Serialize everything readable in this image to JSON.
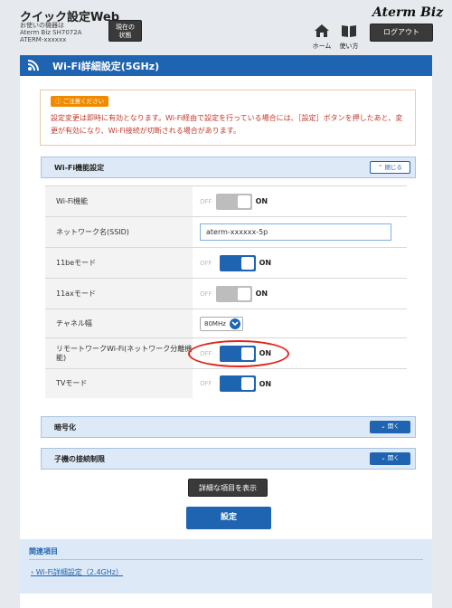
{
  "header": {
    "app_title": "クイック設定Web",
    "device_lines": [
      "お使いの機器は",
      "Aterm Biz SH7072A",
      "ATERM-xxxxxx"
    ],
    "status_button": [
      "現在の",
      "状態"
    ],
    "logo": "Aterm Biz",
    "home_label": "ホーム",
    "manual_label": "使い方",
    "logout_label": "ログアウト"
  },
  "page": {
    "title": "Wi-Fi詳細設定(5GHz)"
  },
  "notice": {
    "tag": "ご注意ください",
    "body": "設定変更は即時に有効となります。Wi-Fi経由で設定を行っている場合には、［設定］ボタンを押したあと、変更が有効になり、Wi-Fi接続が切断される場合があります。"
  },
  "sections": {
    "wifi_function": {
      "title": "Wi-Fi機能設定",
      "toggle": "閉じる"
    },
    "encryption": {
      "title": "暗号化",
      "toggle": "開く"
    },
    "client_limit": {
      "title": "子機の接続制限",
      "toggle": "開く"
    }
  },
  "rows": {
    "wifi": {
      "label": "Wi-Fi機能",
      "off": "OFF",
      "on": "ON",
      "state": "off"
    },
    "ssid": {
      "label": "ネットワーク名(SSID)",
      "value": "aterm-xxxxxx-5p"
    },
    "mode_11be": {
      "label": "11beモード",
      "off": "OFF",
      "on": "ON",
      "state": "on"
    },
    "mode_11ax": {
      "label": "11axモード",
      "off": "OFF",
      "on": "ON",
      "state": "off"
    },
    "bandwidth": {
      "label": "チャネル幅",
      "value": "80MHz"
    },
    "remote_network": {
      "label": "リモートワークWi-Fi(ネットワーク分離機能)",
      "off": "OFF",
      "on": "ON",
      "state": "on"
    },
    "tv_mode": {
      "label": "TVモード",
      "off": "OFF",
      "on": "ON",
      "state": "on"
    }
  },
  "actions": {
    "show_details": "詳細な項目を表示",
    "save": "設定"
  },
  "related": {
    "title": "関連項目",
    "link": "Wi-Fi詳細設定（2.4GHz）"
  },
  "colors": {
    "primary": "#1f64b1",
    "notice_text": "#c0392b",
    "notice_tag": "#f08a00",
    "highlight": "#e0261b"
  }
}
